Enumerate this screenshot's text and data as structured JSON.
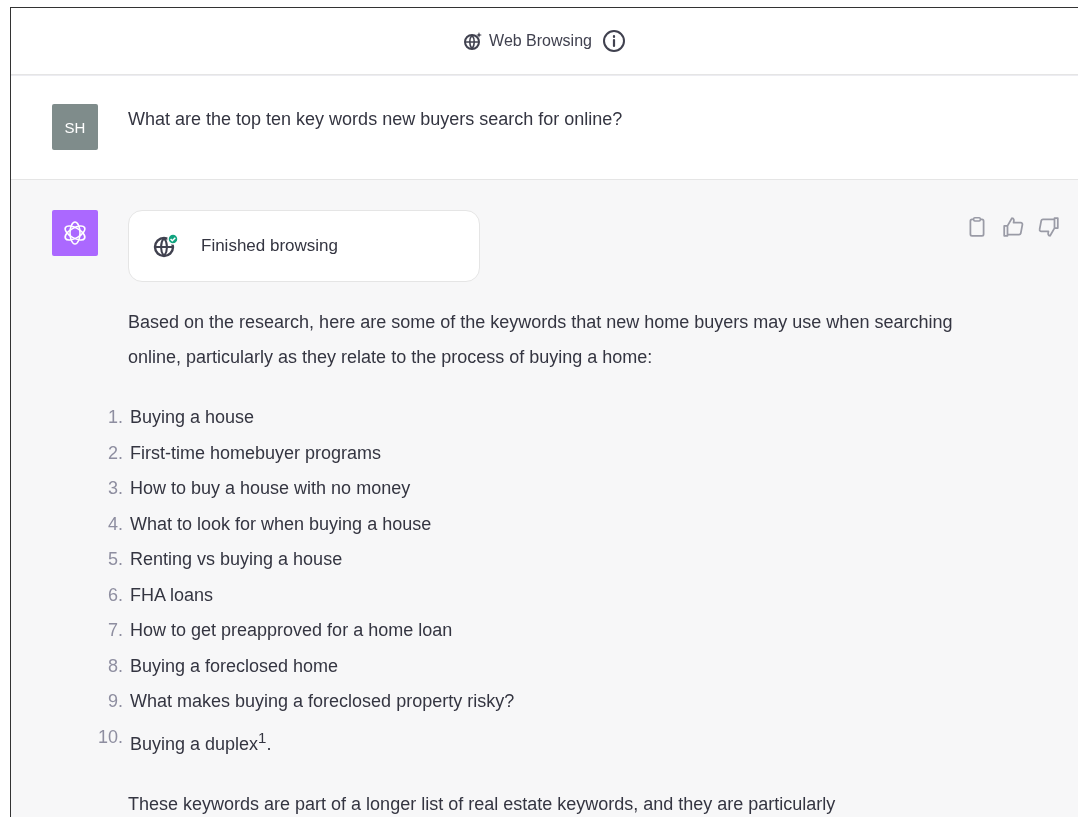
{
  "header": {
    "title": "Web Browsing"
  },
  "user_message": {
    "avatar": "SH",
    "text": "What are the top ten key words new buyers search for online?"
  },
  "assistant_message": {
    "browsing_status": "Finished browsing",
    "intro": "Based on the research, here are some of the keywords that new home buyers may use when searching online, particularly as they relate to the process of buying a home:",
    "list": [
      {
        "number": "1.",
        "text": "Buying a house"
      },
      {
        "number": "2.",
        "text": "First-time homebuyer programs"
      },
      {
        "number": "3.",
        "text": "How to buy a house with no money"
      },
      {
        "number": "4.",
        "text": "What to look for when buying a house"
      },
      {
        "number": "5.",
        "text": "Renting vs buying a house"
      },
      {
        "number": "6.",
        "text": "FHA loans"
      },
      {
        "number": "7.",
        "text": "How to get preapproved for a home loan"
      },
      {
        "number": "8.",
        "text": "Buying a foreclosed home"
      },
      {
        "number": "9.",
        "text": "What makes buying a foreclosed property risky?"
      },
      {
        "number": "10.",
        "text": "Buying a duplex$^{1}$."
      }
    ],
    "closing": "These keywords are part of a longer list of real estate keywords, and they are particularly"
  }
}
